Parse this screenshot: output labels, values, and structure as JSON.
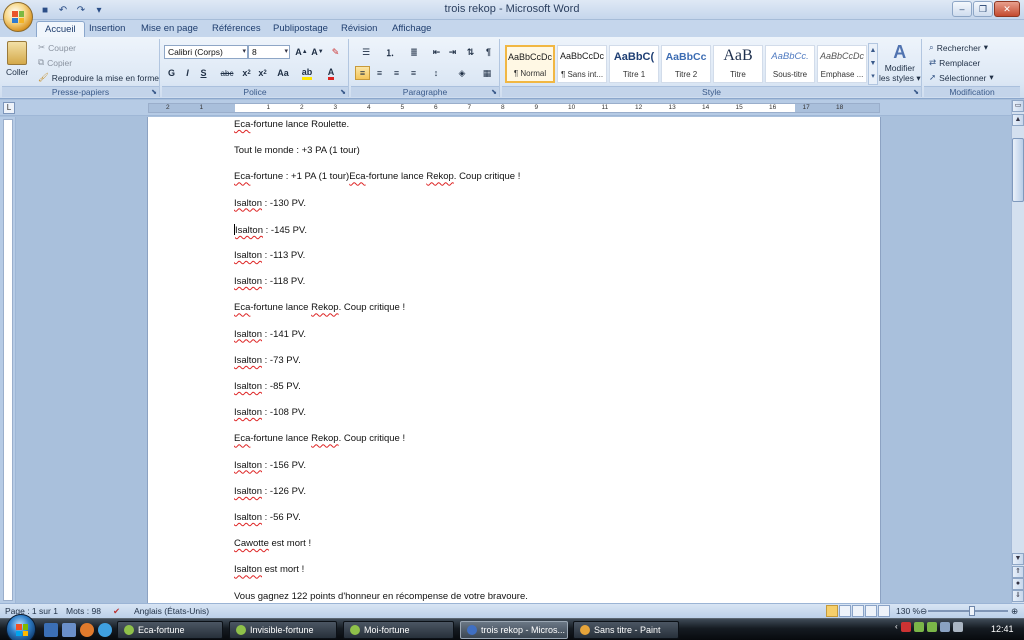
{
  "window": {
    "title": "trois rekop - Microsoft Word"
  },
  "quick_access": [
    "save-icon",
    "undo-icon",
    "redo-icon",
    "customize-icon"
  ],
  "tabs": [
    "Accueil",
    "Insertion",
    "Mise en page",
    "Références",
    "Publipostage",
    "Révision",
    "Affichage"
  ],
  "ribbon": {
    "clipboard": {
      "label": "Presse-papiers",
      "paste": "Coller",
      "cut": "Couper",
      "copy": "Copier",
      "format_painter": "Reproduire la mise en forme"
    },
    "font": {
      "label": "Police",
      "family": "Calibri (Corps)",
      "size": "8"
    },
    "paragraph": {
      "label": "Paragraphe"
    },
    "styles": {
      "label": "Style",
      "items": [
        {
          "sample": "AaBbCcDc",
          "name": "¶ Normal"
        },
        {
          "sample": "AaBbCcDc",
          "name": "¶ Sans int..."
        },
        {
          "sample": "AaBbC(",
          "name": "Titre 1"
        },
        {
          "sample": "AaBbCc",
          "name": "Titre 2"
        },
        {
          "sample": "AaB",
          "name": "Titre"
        },
        {
          "sample": "AaBbCc.",
          "name": "Sous-titre"
        },
        {
          "sample": "AaBbCcDc",
          "name": "Emphase ..."
        }
      ],
      "change_styles_line1": "Modifier",
      "change_styles_line2": "les styles"
    },
    "editing": {
      "label": "Modification",
      "find": "Rechercher",
      "replace": "Remplacer",
      "select": "Sélectionner"
    }
  },
  "ruler_numbers": [
    "2",
    "1",
    "1",
    "2",
    "3",
    "4",
    "5",
    "6",
    "7",
    "8",
    "9",
    "10",
    "11",
    "12",
    "13",
    "14",
    "15",
    "16",
    "17",
    "18"
  ],
  "document": {
    "paragraphs": [
      {
        "parts": [
          {
            "t": "Eca",
            "sq": true
          },
          {
            "t": "-fortune lance Roulette."
          }
        ]
      },
      {
        "parts": [
          {
            "t": "Tout le monde : +3 PA (1 tour)"
          }
        ]
      },
      {
        "parts": [
          {
            "t": "Eca",
            "sq": true
          },
          {
            "t": "-fortune : +1 PA (1 tour)"
          },
          {
            "t": "Eca",
            "sq": true
          },
          {
            "t": "-fortune lance "
          },
          {
            "t": "Rekop",
            "sq": true
          },
          {
            "t": ". Coup critique !"
          }
        ]
      },
      {
        "parts": [
          {
            "t": "Isalton",
            "sq": true
          },
          {
            "t": " : -130 PV."
          }
        ]
      },
      {
        "parts": [
          {
            "t": "Isalton",
            "sq": true,
            "caret": true
          },
          {
            "t": " : -145 PV."
          }
        ]
      },
      {
        "parts": [
          {
            "t": "Isalton",
            "sq": true
          },
          {
            "t": " : -113 PV."
          }
        ]
      },
      {
        "parts": [
          {
            "t": "Isalton",
            "sq": true
          },
          {
            "t": " : -118 PV."
          }
        ]
      },
      {
        "parts": [
          {
            "t": "Eca",
            "sq": true
          },
          {
            "t": "-fortune lance "
          },
          {
            "t": "Rekop",
            "sq": true
          },
          {
            "t": ". Coup critique !"
          }
        ]
      },
      {
        "parts": [
          {
            "t": "Isalton",
            "sq": true
          },
          {
            "t": " : -141 PV."
          }
        ]
      },
      {
        "parts": [
          {
            "t": "Isalton",
            "sq": true
          },
          {
            "t": " : -73 PV."
          }
        ]
      },
      {
        "parts": [
          {
            "t": "Isalton",
            "sq": true
          },
          {
            "t": " : -85 PV."
          }
        ]
      },
      {
        "parts": [
          {
            "t": "Isalton",
            "sq": true
          },
          {
            "t": " : -108 PV."
          }
        ]
      },
      {
        "parts": [
          {
            "t": "Eca",
            "sq": true
          },
          {
            "t": "-fortune lance "
          },
          {
            "t": "Rekop",
            "sq": true
          },
          {
            "t": ". Coup critique !"
          }
        ]
      },
      {
        "parts": [
          {
            "t": "Isalton",
            "sq": true
          },
          {
            "t": " : -156 PV."
          }
        ]
      },
      {
        "parts": [
          {
            "t": "Isalton",
            "sq": true
          },
          {
            "t": " : -126 PV."
          }
        ]
      },
      {
        "parts": [
          {
            "t": "Isalton",
            "sq": true
          },
          {
            "t": " : -56 PV."
          }
        ]
      },
      {
        "parts": [
          {
            "t": "Cawotte",
            "sq": true
          },
          {
            "t": " est mort !"
          }
        ]
      },
      {
        "parts": [
          {
            "t": "Isalton",
            "sq": true
          },
          {
            "t": " est mort !"
          }
        ]
      },
      {
        "parts": [
          {
            "t": "Vous gagnez 122 points d'honneur  en récompense de votre bravoure."
          }
        ]
      }
    ]
  },
  "statusbar": {
    "page": "Page : 1 sur 1",
    "words": "Mots : 98",
    "language": "Anglais (États-Unis)",
    "zoom": "130 %",
    "zoom_level": 0.56
  },
  "taskbar": {
    "items": [
      {
        "label": "Eca-fortune",
        "color": "#8fc14a"
      },
      {
        "label": "Invisible-fortune",
        "color": "#8fc14a"
      },
      {
        "label": "Moi-fortune",
        "color": "#8fc14a"
      },
      {
        "label": "trois rekop - Micros...",
        "color": "#3f6fc2",
        "active": true
      },
      {
        "label": "Sans titre - Paint",
        "color": "#e6a43a"
      }
    ],
    "clock": "12:41"
  }
}
